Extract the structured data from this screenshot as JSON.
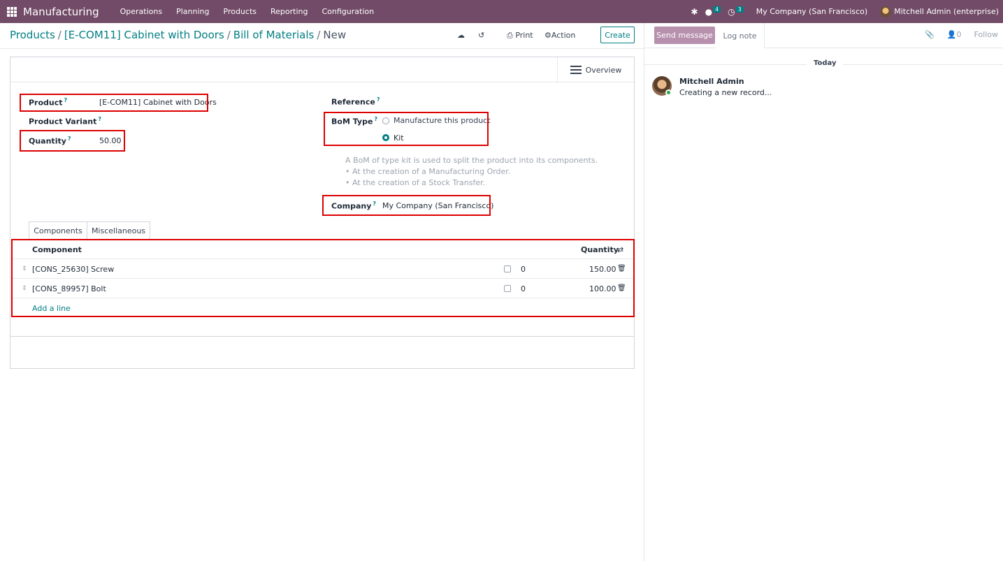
{
  "navbar": {
    "brand": "Manufacturing",
    "menu": [
      "Operations",
      "Planning",
      "Products",
      "Reporting",
      "Configuration"
    ],
    "messages_count": "4",
    "activities_count": "3",
    "company": "My Company (San Francisco)",
    "user": "Mitchell Admin (enterprise)"
  },
  "breadcrumb": {
    "items": [
      "Products",
      "[E-COM11] Cabinet with Doors",
      "Bill of Materials"
    ],
    "separator": "/",
    "current": "New"
  },
  "toolbar": {
    "print_label": "Print",
    "action_label": "Action",
    "create_label": "Create"
  },
  "statusbar": {
    "overview_label": "Overview"
  },
  "form": {
    "product_label": "Product",
    "product_value": "[E-COM11] Cabinet with Doors",
    "variant_label": "Product Variant",
    "quantity_label": "Quantity",
    "quantity_value": "50.00",
    "reference_label": "Reference",
    "bom_type_label": "BoM Type",
    "bom_type_options": [
      "Manufacture this product",
      "Kit"
    ],
    "bom_type_selected": "Kit",
    "help_lines": [
      "A BoM of type kit is used to split the product into its components.",
      "•  At the creation of a Manufacturing Order.",
      "•  At the creation of a Stock Transfer."
    ],
    "company_label": "Company",
    "company_value": "My Company (San Francisco)",
    "help_marker": "?"
  },
  "tabs": [
    "Components",
    "Miscellaneous"
  ],
  "components": {
    "headers": {
      "component": "Component",
      "quantity": "Quantity"
    },
    "rows": [
      {
        "component": "[CONS_25630] Screw",
        "consumed": "0",
        "quantity": "150.00"
      },
      {
        "component": "[CONS_89957] Bolt",
        "consumed": "0",
        "quantity": "100.00"
      }
    ],
    "add_line_label": "Add a line"
  },
  "chatter": {
    "send_message_label": "Send message",
    "log_note_label": "Log note",
    "followers_count": "0",
    "follow_label": "Follow",
    "date_separator": "Today",
    "messages": [
      {
        "author": "Mitchell Admin",
        "body": "Creating a new record..."
      }
    ]
  },
  "colors": {
    "navbar": "#714B67",
    "accent": "#017e84",
    "highlight_border": "#dd0000"
  }
}
